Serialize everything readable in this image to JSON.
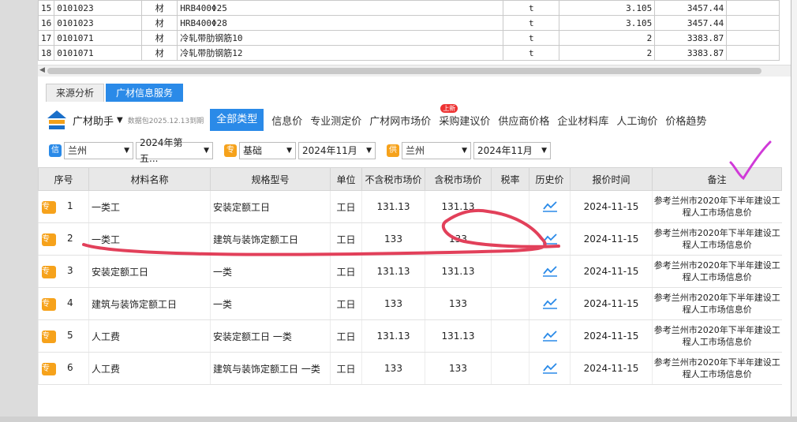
{
  "top_rows": [
    {
      "no": "15",
      "code": "0101023",
      "type": "材",
      "spec": "HRB400Φ25",
      "unit": "t",
      "qty": "3.105",
      "price": "3457.44"
    },
    {
      "no": "16",
      "code": "0101023",
      "type": "材",
      "spec": "HRB400Φ28",
      "unit": "t",
      "qty": "3.105",
      "price": "3457.44"
    },
    {
      "no": "17",
      "code": "0101071",
      "type": "材",
      "spec": "冷轧带肋钢筋10",
      "unit": "t",
      "qty": "2",
      "price": "3383.87"
    },
    {
      "no": "18",
      "code": "0101071",
      "type": "材",
      "spec": "冷轧带肋钢筋12",
      "unit": "t",
      "qty": "2",
      "price": "3383.87"
    }
  ],
  "tabs": [
    "来源分析",
    "广材信息服务"
  ],
  "brand": {
    "name": "广材助手",
    "sub": "数据包2025.12.13到期"
  },
  "categories": [
    "全部类型",
    "信息价",
    "专业测定价",
    "广材网市场价",
    "采购建议价",
    "供应商价格",
    "企业材料库",
    "人工询价",
    "价格趋势"
  ],
  "new_badge": "上新",
  "filters": {
    "f1_icon": "信",
    "f1_city": "兰州",
    "f1_period": "2024年第五...",
    "f2_icon": "专",
    "f2_type": "基础",
    "f2_month": "2024年11月",
    "f3_icon": "供",
    "f3_city": "兰州",
    "f3_month": "2024年11月"
  },
  "headers": [
    "序号",
    "材料名称",
    "规格型号",
    "单位",
    "不含税市场价",
    "含税市场价",
    "税率",
    "历史价",
    "报价时间",
    "备注"
  ],
  "badge": "专",
  "rows": [
    {
      "no": "1",
      "name": "一类工",
      "spec": "安装定额工日",
      "unit": "工日",
      "p1": "131.13",
      "p2": "131.13",
      "tax": "",
      "time": "2024-11-15",
      "remark": "参考兰州市2020年下半年建设工程人工市场信息价"
    },
    {
      "no": "2",
      "name": "一类工",
      "spec": "建筑与装饰定额工日",
      "unit": "工日",
      "p1": "133",
      "p2": "133",
      "tax": "",
      "time": "2024-11-15",
      "remark": "参考兰州市2020年下半年建设工程人工市场信息价"
    },
    {
      "no": "3",
      "name": "安装定额工日",
      "spec": "一类",
      "unit": "工日",
      "p1": "131.13",
      "p2": "131.13",
      "tax": "",
      "time": "2024-11-15",
      "remark": "参考兰州市2020年下半年建设工程人工市场信息价"
    },
    {
      "no": "4",
      "name": "建筑与装饰定额工日",
      "spec": "一类",
      "unit": "工日",
      "p1": "133",
      "p2": "133",
      "tax": "",
      "time": "2024-11-15",
      "remark": "参考兰州市2020年下半年建设工程人工市场信息价"
    },
    {
      "no": "5",
      "name": "人工费",
      "spec": "安装定额工日 一类",
      "unit": "工日",
      "p1": "131.13",
      "p2": "131.13",
      "tax": "",
      "time": "2024-11-15",
      "remark": "参考兰州市2020年下半年建设工程人工市场信息价"
    },
    {
      "no": "6",
      "name": "人工费",
      "spec": "建筑与装饰定额工日 一类",
      "unit": "工日",
      "p1": "133",
      "p2": "133",
      "tax": "",
      "time": "2024-11-15",
      "remark": "参考兰州市2020年下半年建设工程人工市场信息价"
    }
  ],
  "colors": {
    "accent": "#2a8ae8",
    "badge": "#f6a21b",
    "annotation_red": "#e2405a",
    "annotation_pink": "#d03ad8"
  }
}
